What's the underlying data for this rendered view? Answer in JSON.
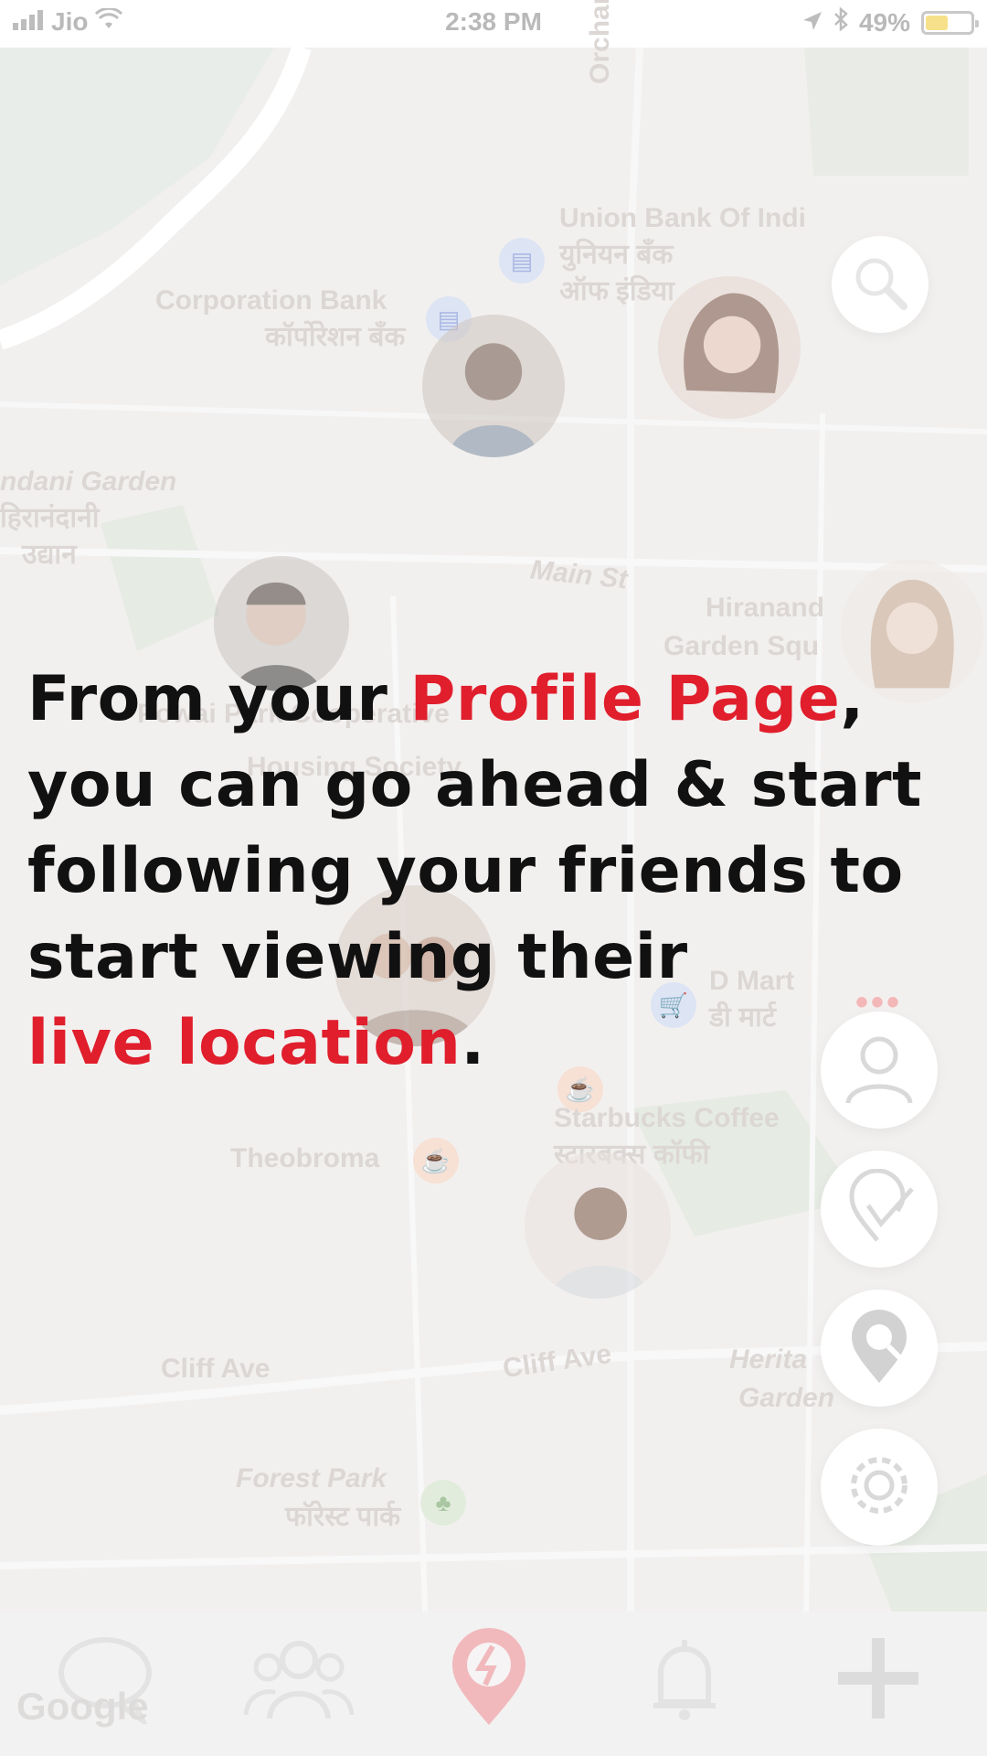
{
  "status_bar": {
    "carrier": "Jio",
    "time": "2:38 PM",
    "battery_percent": "49%",
    "battery_level": 0.49,
    "icons": [
      "signal-bars-icon",
      "wifi-icon",
      "location-arrow-icon",
      "bluetooth-icon",
      "battery-icon"
    ]
  },
  "map": {
    "labels": {
      "orchard": "Orchard",
      "union_bank": "Union Bank Of Indi",
      "union_bank_hi_1": "युनियन बँक",
      "union_bank_hi_2": "ऑफ इंडिया",
      "corporation_bank": "Corporation Bank",
      "corporation_bank_hi": "कॉर्पोरेशन बँक",
      "garden": "ndani Garden",
      "garden_hi_1": "हिरानंदानी",
      "garden_hi_2": "उद्यान",
      "main_st": "Main St",
      "hiranand_1": "Hiranand",
      "hiranand_2": "Garden Squ",
      "powai_1": "Powai Park Cooperative",
      "powai_2": "Housing Society",
      "d_mart": "D Mart",
      "d_mart_hi": "डी मार्ट",
      "starbucks": "Starbucks Coffee",
      "starbucks_hi": "स्टारबक्स कॉफी",
      "theobroma": "Theobroma",
      "cliff_ave_1": "Cliff Ave",
      "cliff_ave_2": "Cliff Ave",
      "heritage_1": "Herita",
      "heritage_2": "Garden",
      "forest_park": "Forest Park",
      "forest_park_hi": "फॉरेस्ट पार्क",
      "google": "Google"
    }
  },
  "overlay": {
    "line1_a": "From your ",
    "line1_highlight": "Profile Page",
    "line1_b": ",",
    "line2": "you can go ahead & start",
    "line3": "following your friends to",
    "line4": "start viewing their",
    "line5_highlight": "live location",
    "line5_b": "."
  },
  "more_dots": "•••",
  "side_buttons": [
    "profile-icon",
    "checkin-icon",
    "location-search-icon",
    "settings-gear-icon"
  ],
  "tab_bar": {
    "tabs": [
      "chat-icon",
      "friends-icon",
      "app-logo-icon",
      "notifications-bell-icon",
      "add-plus-icon"
    ]
  },
  "colors": {
    "accent": "#e01e2c",
    "text": "#111111",
    "map_bg": "#f2f0ef"
  }
}
